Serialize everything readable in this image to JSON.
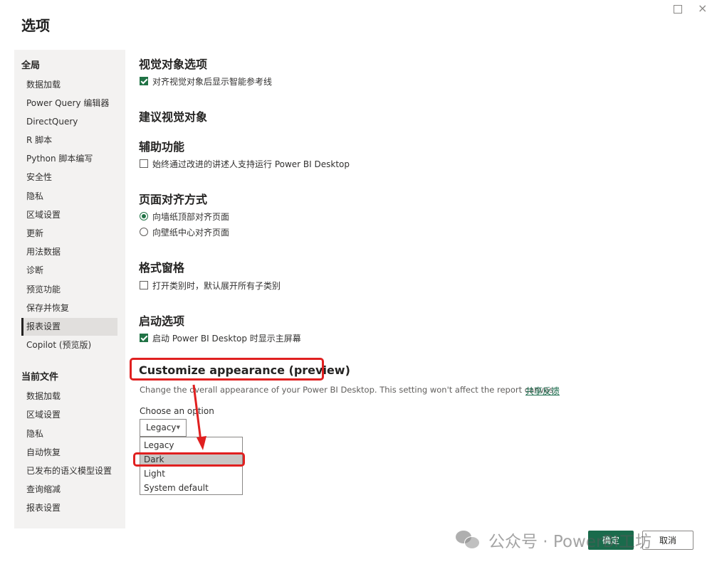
{
  "window": {
    "title": "选项",
    "close_glyph": "×"
  },
  "sidebar": {
    "global_header": "全局",
    "global_items": [
      "数据加载",
      "Power Query 编辑器",
      "DirectQuery",
      "R 脚本",
      "Python 脚本编写",
      "安全性",
      "隐私",
      "区域设置",
      "更新",
      "用法数据",
      "诊断",
      "预览功能",
      "保存并恢复",
      "报表设置",
      "Copilot (预览版)"
    ],
    "current_header": "当前文件",
    "current_items": [
      "数据加载",
      "区域设置",
      "隐私",
      "自动恢复",
      "已发布的语义模型设置",
      "查询缩减",
      "报表设置"
    ],
    "selected_item": "报表设置"
  },
  "main": {
    "visual_options": {
      "heading": "视觉对象选项",
      "checkbox_label": "对齐视觉对象后显示智能参考线",
      "checked": true
    },
    "suggested_visuals": {
      "heading": "建议视觉对象"
    },
    "accessibility": {
      "heading": "辅助功能",
      "checkbox_label": "始终通过改进的讲述人支持运行 Power BI Desktop",
      "checked": false
    },
    "page_alignment": {
      "heading": "页面对齐方式",
      "options": [
        "向墙纸顶部对齐页面",
        "向壁纸中心对齐页面"
      ],
      "selected": "向墙纸顶部对齐页面"
    },
    "format_pane": {
      "heading": "格式窗格",
      "checkbox_label": "打开类别时，默认展开所有子类别",
      "checked": false
    },
    "startup": {
      "heading": "启动选项",
      "checkbox_label": "启动 Power BI Desktop 时显示主屏幕",
      "checked": true
    },
    "customize_appearance": {
      "heading": "Customize appearance (preview)",
      "description": "Change the overall appearance of your Power BI Desktop. This setting won't affect the report canvas.",
      "feedback_link": "共享反馈",
      "choose_label": "Choose an option",
      "current_value": "Legacy",
      "dropdown_arrow": "▼",
      "options": [
        "Legacy",
        "Dark",
        "Light",
        "System default"
      ],
      "highlighted_option": "Dark"
    }
  },
  "footer": {
    "ok_label": "确定",
    "cancel_label": "取消"
  },
  "watermark": {
    "text": "公众号 · PowerBI工坊"
  },
  "colors": {
    "accent": "#217346",
    "button_primary": "#1a6b4c",
    "annotation_red": "#e02020",
    "sidebar_bg": "#f3f2f1",
    "highlight_bg": "#c8c6c4"
  }
}
